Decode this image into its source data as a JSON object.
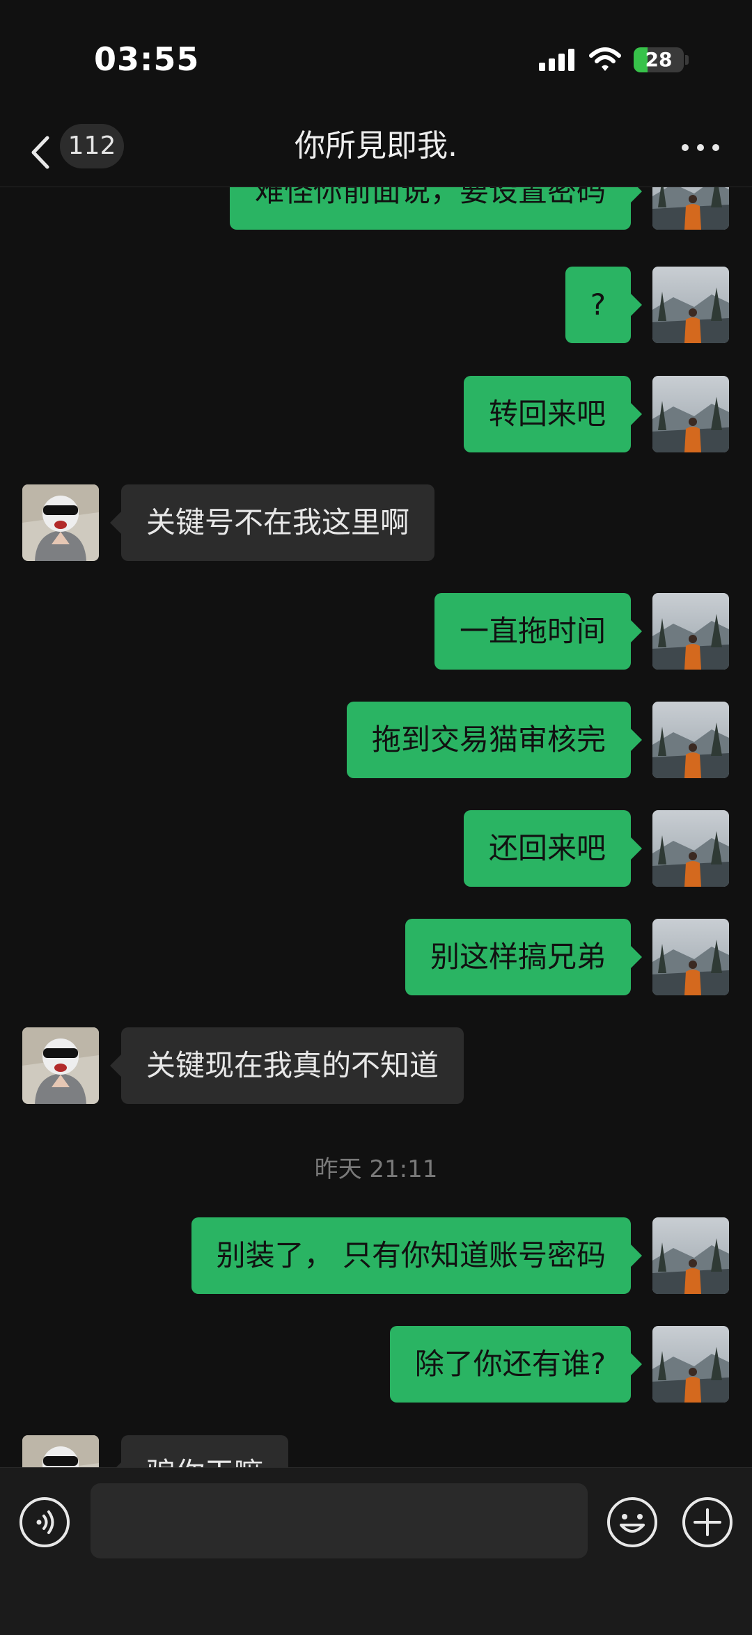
{
  "status_bar": {
    "time": "03:55",
    "battery": "28",
    "battery_level_percent": 28
  },
  "header": {
    "unread_count": "112",
    "title": "你所見即我."
  },
  "colors": {
    "background": "#111111",
    "outgoing_bubble": "#2ab463",
    "incoming_bubble": "#2c2c2c",
    "accent_green": "#37c24a"
  },
  "icons": {
    "back": "chevron-left-icon",
    "more": "more-dots-icon",
    "voice": "voice-icon",
    "emoji": "emoji-icon",
    "plus": "plus-icon"
  },
  "messages": [
    {
      "side": "out",
      "text": "难怪你前面说，要设置密码"
    },
    {
      "side": "out",
      "text": "?"
    },
    {
      "side": "out",
      "text": "转回来吧"
    },
    {
      "side": "in",
      "text": "关键号不在我这里啊"
    },
    {
      "side": "out",
      "text": "一直拖时间"
    },
    {
      "side": "out",
      "text": "拖到交易猫审核完"
    },
    {
      "side": "out",
      "text": "还回来吧"
    },
    {
      "side": "out",
      "text": "别这样搞兄弟"
    },
    {
      "side": "in",
      "text": "关键现在我真的不知道"
    },
    {
      "side": "time",
      "text": "昨天 21:11"
    },
    {
      "side": "out",
      "text": "别装了， 只有你知道账号密码"
    },
    {
      "side": "out",
      "text": "除了你还有谁?"
    },
    {
      "side": "in",
      "text": "骗你干嘛"
    }
  ],
  "input_bar": {
    "message_value": ""
  }
}
